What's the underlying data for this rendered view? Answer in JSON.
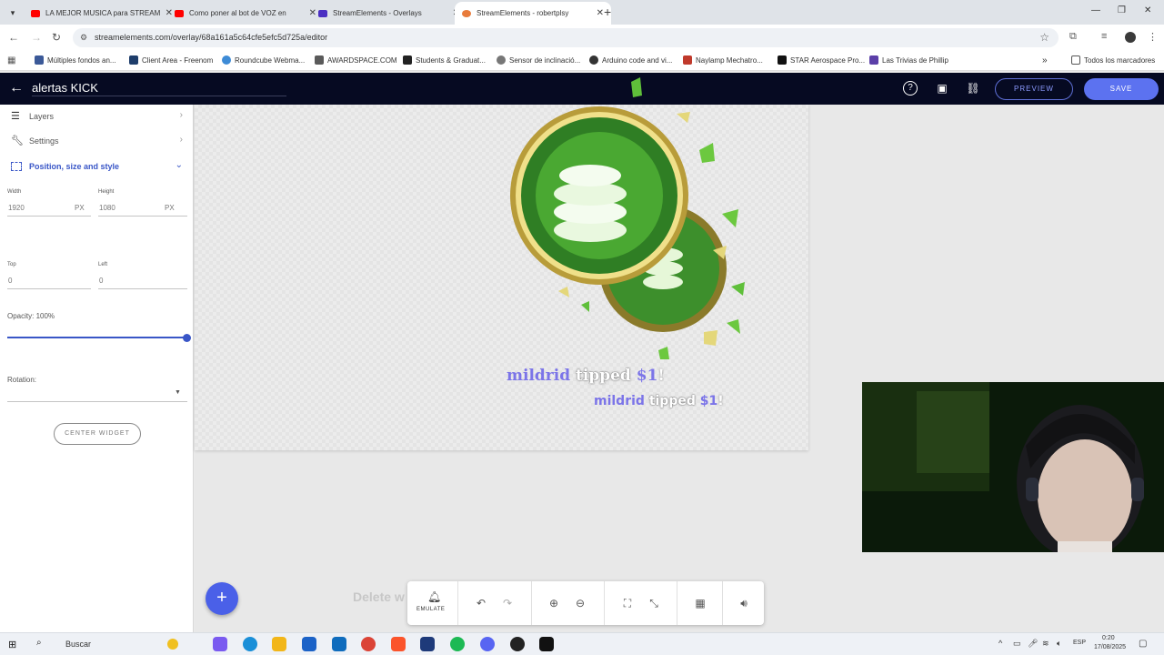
{
  "browser": {
    "tabs": [
      {
        "label": "LA MEJOR MUSICA para STREAM",
        "fav_color": "#ff0000",
        "active": false
      },
      {
        "label": "Como poner al bot de VOZ en",
        "fav_color": "#ff0000",
        "active": false
      },
      {
        "label": "StreamElements - Overlays",
        "fav_color": "#4a2fc2",
        "active": false
      },
      {
        "label": "StreamElements - robertplsy",
        "fav_color": "#e87b3b",
        "active": true
      }
    ],
    "url": "streamelements.com/overlay/68a161a5c64cfe5efc5d725a/editor",
    "bookmarks": [
      {
        "label": "Múltiples fondos an...",
        "color": "#3b5998"
      },
      {
        "label": "Client Area - Freenom",
        "color": "#1e3d6b"
      },
      {
        "label": "Roundcube Webma...",
        "color": "#3d8bd6"
      },
      {
        "label": "AWARDSPACE.COM",
        "color": "#5a5a5a"
      },
      {
        "label": "Students & Graduat...",
        "color": "#222222"
      },
      {
        "label": "Sensor de inclinació...",
        "color": "#777777"
      },
      {
        "label": "Arduino code and vi...",
        "color": "#333333"
      },
      {
        "label": "Naylamp Mechatro...",
        "color": "#c0392b"
      },
      {
        "label": "STAR Aerospace Pro...",
        "color": "#111111"
      },
      {
        "label": "Las Trivias de Phillip",
        "color": "#5b3fa8"
      }
    ],
    "all_bookmarks_label": "Todos los marcadores"
  },
  "header": {
    "title": "alertas KICK",
    "preview_label": "PREVIEW",
    "save_label": "SAVE"
  },
  "panel": {
    "layers_label": "Layers",
    "settings_label": "Settings",
    "position_label": "Position, size and style",
    "width_label": "Width",
    "width_value": "1920",
    "height_label": "Height",
    "height_value": "1080",
    "unit": "PX",
    "top_label": "Top",
    "top_value": "0",
    "left_label": "Left",
    "left_value": "0",
    "opacity_label": "Opacity: 100%",
    "opacity_value": 1.0,
    "rotation_label": "Rotation:",
    "center_label": "CENTER WIDGET"
  },
  "canvas": {
    "alert1": {
      "name": "mildrid",
      "verb": "tipped",
      "amount": "$1",
      "bang": "!"
    },
    "alert2": {
      "name": "mildrid",
      "verb": "tipped",
      "amount": "$1",
      "bang": "!"
    },
    "delete_hint": "Delete w"
  },
  "toolbar": {
    "emulate_label": "EMULATE"
  },
  "taskbar": {
    "search_label": "Buscar",
    "language": "ESP",
    "time": "0:20",
    "date": "17/08/2025"
  },
  "colors": {
    "accent": "#5c72f0",
    "header_bg": "#060a22",
    "alert_name": "#7b74e8"
  }
}
